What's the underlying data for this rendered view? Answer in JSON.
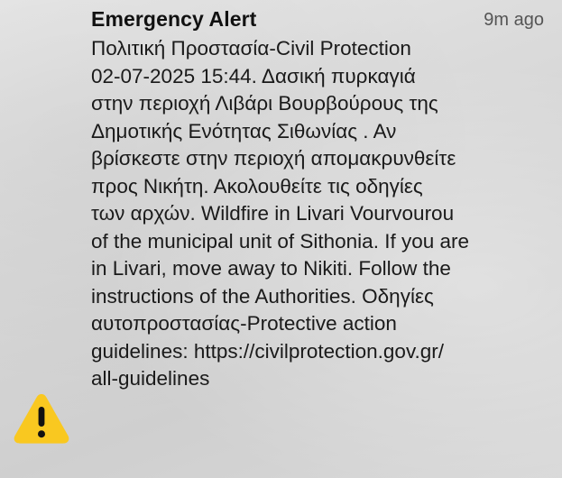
{
  "notification": {
    "title": "Emergency Alert",
    "timestamp": "9m ago",
    "icon": "warning-triangle-icon",
    "icon_color": "#F9C820",
    "body_lines": [
      "Πολιτική Προστασία-Civil Protection",
      "02-07-2025 15:44. Δασική πυρκαγιά",
      "στην περιοχή Λιβάρι Βουρβούρους της",
      "Δημοτικής Ενότητας Σιθωνίας . Αν",
      "βρίσκεστε στην περιοχή  απομακρυνθείτε",
      "προς Νικήτη. Ακολουθείτε τις οδηγίες",
      "των αρχών. Wildfire in Livari Vourvourou",
      "of the municipal unit of Sithonia. If you are",
      "in Livari, move away to Nikiti. Follow the",
      "instructions of the Authorities. Οδηγίες",
      "αυτοπροστασίας-Protective action",
      "guidelines: https://civilprotection.gov.gr/",
      "all-guidelines"
    ]
  }
}
